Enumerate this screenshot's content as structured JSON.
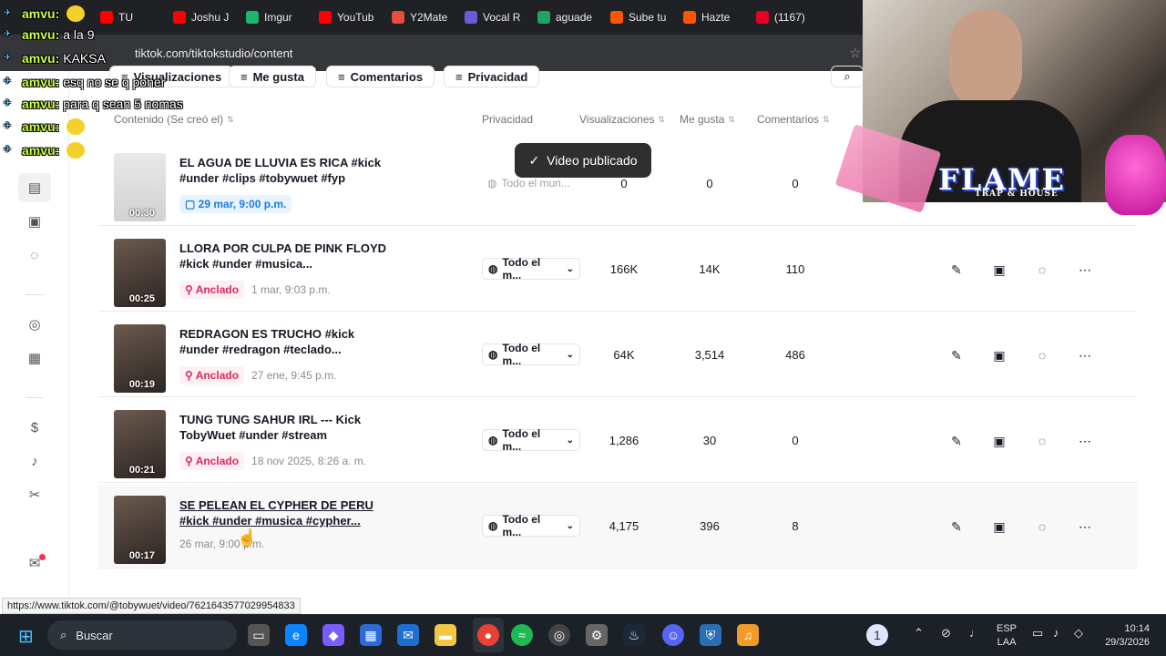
{
  "browser": {
    "url": "tiktok.com/tiktokstudio/content",
    "bookmarks": [
      {
        "label": "TU",
        "color": "#ff0000"
      },
      {
        "label": "Joshu J",
        "color": "#ff0000"
      },
      {
        "label": "Imgur",
        "color": "#1bb76e"
      },
      {
        "label": "YouTub",
        "color": "#ff0000"
      },
      {
        "label": "Y2Mate",
        "color": "#e84c3d"
      },
      {
        "label": "Vocal R",
        "color": "#6b5bd6"
      },
      {
        "label": "aguade",
        "color": "#1fa463"
      },
      {
        "label": "Sube tu",
        "color": "#ff5500"
      },
      {
        "label": "Hazte",
        "color": "#ff5500"
      },
      {
        "label": "(1167)",
        "color": "#e60023"
      }
    ],
    "status_url": "https://www.tiktok.com/@tobywuet/video/7621643577029954833"
  },
  "chat_overlay": [
    {
      "user": "amvu:",
      "text": ""
    },
    {
      "user": "amvu:",
      "text": "a la 9"
    },
    {
      "user": "amvu:",
      "text": "KAKSA"
    },
    {
      "user": "amvu:",
      "text": "esq no se q poner"
    },
    {
      "user": "amvu:",
      "text": "para q sean 5 nomas"
    },
    {
      "user": "amvu:",
      "text": ""
    },
    {
      "user": "amvu:",
      "text": ""
    }
  ],
  "filters": [
    "Visualizaciones",
    "Me gusta",
    "Comentarios",
    "Privacidad"
  ],
  "table": {
    "headers": {
      "content": "Contenido (Se creó el)",
      "privacy": "Privacidad",
      "views": "Visualizaciones",
      "likes": "Me gusta",
      "comments": "Comentarios"
    },
    "rows": [
      {
        "title": "EL AGUA DE LLUVIA ES RICA #kick #under #clips #tobywuet #fyp",
        "duration": "00:30",
        "badge": "",
        "date": "29 mar, 9:00 p.m.",
        "privacy": "Todo el mun...",
        "views": "0",
        "likes": "0",
        "comments": "0"
      },
      {
        "title": "LLORA POR CULPA DE PINK FLOYD #kick #under #musica...",
        "duration": "00:25",
        "badge": "Anclado",
        "date": "1 mar, 9:03 p.m.",
        "privacy": "Todo el m...",
        "views": "166K",
        "likes": "14K",
        "comments": "110"
      },
      {
        "title": "REDRAGON ES TRUCHO #kick #under #redragon #teclado...",
        "duration": "00:19",
        "badge": "Anclado",
        "date": "27 ene, 9:45 p.m.",
        "privacy": "Todo el m...",
        "views": "64K",
        "likes": "3,514",
        "comments": "486"
      },
      {
        "title": "TUNG TUNG SAHUR IRL --- Kick TobyWuet #under #stream",
        "duration": "00:21",
        "badge": "Anclado",
        "date": "18 nov 2025, 8:26 a. m.",
        "privacy": "Todo el m...",
        "views": "1,286",
        "likes": "30",
        "comments": "0"
      },
      {
        "title": "SE PELEAN EL CYPHER DE PERU #kick #under #musica #cypher...",
        "duration": "00:17",
        "badge": "",
        "date": "26 mar, 9:00 p.m.",
        "privacy": "Todo el m...",
        "views": "4,175",
        "likes": "396",
        "comments": "8"
      }
    ]
  },
  "toast": "Video publicado",
  "overlay": {
    "brand": "FLAME",
    "brand_sub": "TRAP & HOUSE"
  },
  "taskbar": {
    "search_placeholder": "Buscar",
    "lang_line1": "ESP",
    "lang_line2": "LAA",
    "time": "10:14",
    "date": "29/3/2026",
    "notification_count": "1"
  }
}
